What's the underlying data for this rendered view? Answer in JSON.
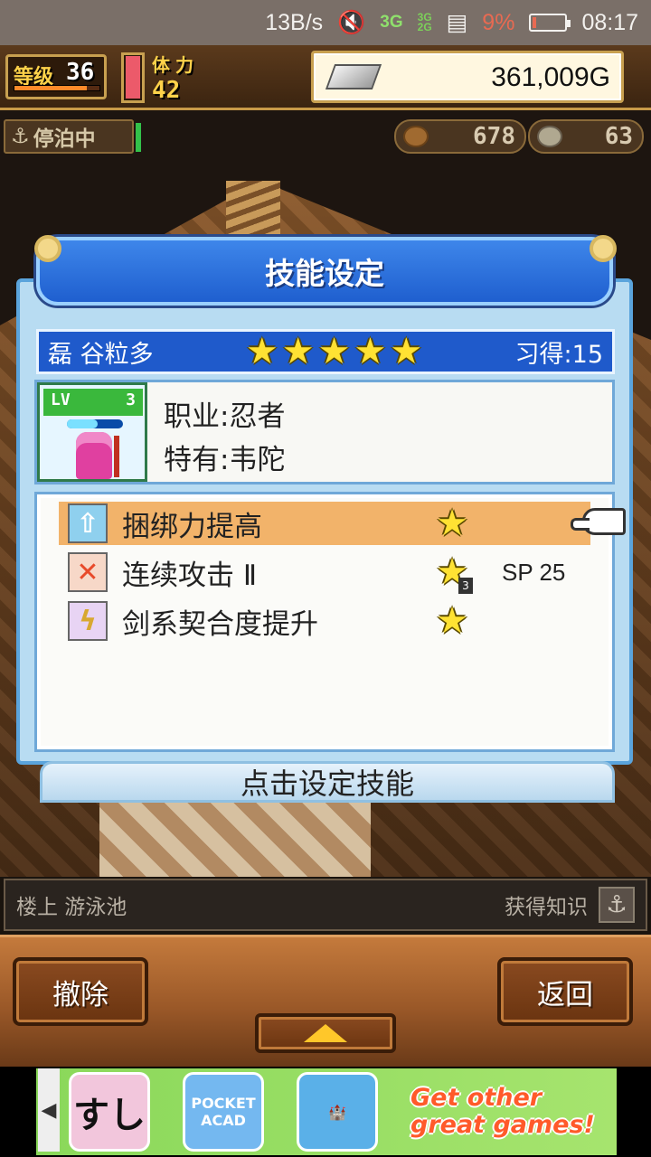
{
  "status_bar": {
    "net_speed": "13B/s",
    "network_top": "3G",
    "network_bottom": "2G",
    "network_main": "3G",
    "battery": "9%",
    "battery_level": 0.09,
    "time": "08:17"
  },
  "hud": {
    "level_label": "等级",
    "level_value": "36",
    "level_progress": 0.85,
    "stamina_label": "体力",
    "stamina_value": "42",
    "stamina_fill": 0.95,
    "money": "361,009G",
    "docked_label": "停泊中",
    "stat_1": "678",
    "stat_2": "63"
  },
  "dialog": {
    "title": "技能设定",
    "character": {
      "name": "磊 谷粒多",
      "stars": 5,
      "learned": "习得:15",
      "lv_label": "LV",
      "lv_value": "3",
      "job": "职业:忍者",
      "unique": "特有:韦陀"
    },
    "skills": [
      {
        "icon": "up-arrow-icon",
        "icon_color": "#8fd0ee",
        "name": "捆绑力提高",
        "selected": true,
        "badge": "",
        "sp": ""
      },
      {
        "icon": "crossed-swords-icon",
        "icon_color": "#e84a2a",
        "name": "连续攻击 Ⅱ",
        "selected": false,
        "badge": "3",
        "sp": "SP 25"
      },
      {
        "icon": "lightning-icon",
        "icon_color": "#c89ae0",
        "name": "剑系契合度提升",
        "selected": false,
        "badge": "",
        "sp": ""
      }
    ],
    "action_bar": "点击设定技能"
  },
  "location": {
    "text": "楼上 游泳池",
    "knowledge": "获得知识"
  },
  "buttons": {
    "remove": "撤除",
    "back": "返回"
  },
  "ad": {
    "text_line1": "Get other",
    "text_line2": "great games!",
    "app1": "すし",
    "app2": "POCKET ACAD"
  },
  "colors": {
    "dialog_blue": "#1f5acb",
    "selected_row": "#f2b36a",
    "star_yellow": "#ffe233"
  }
}
